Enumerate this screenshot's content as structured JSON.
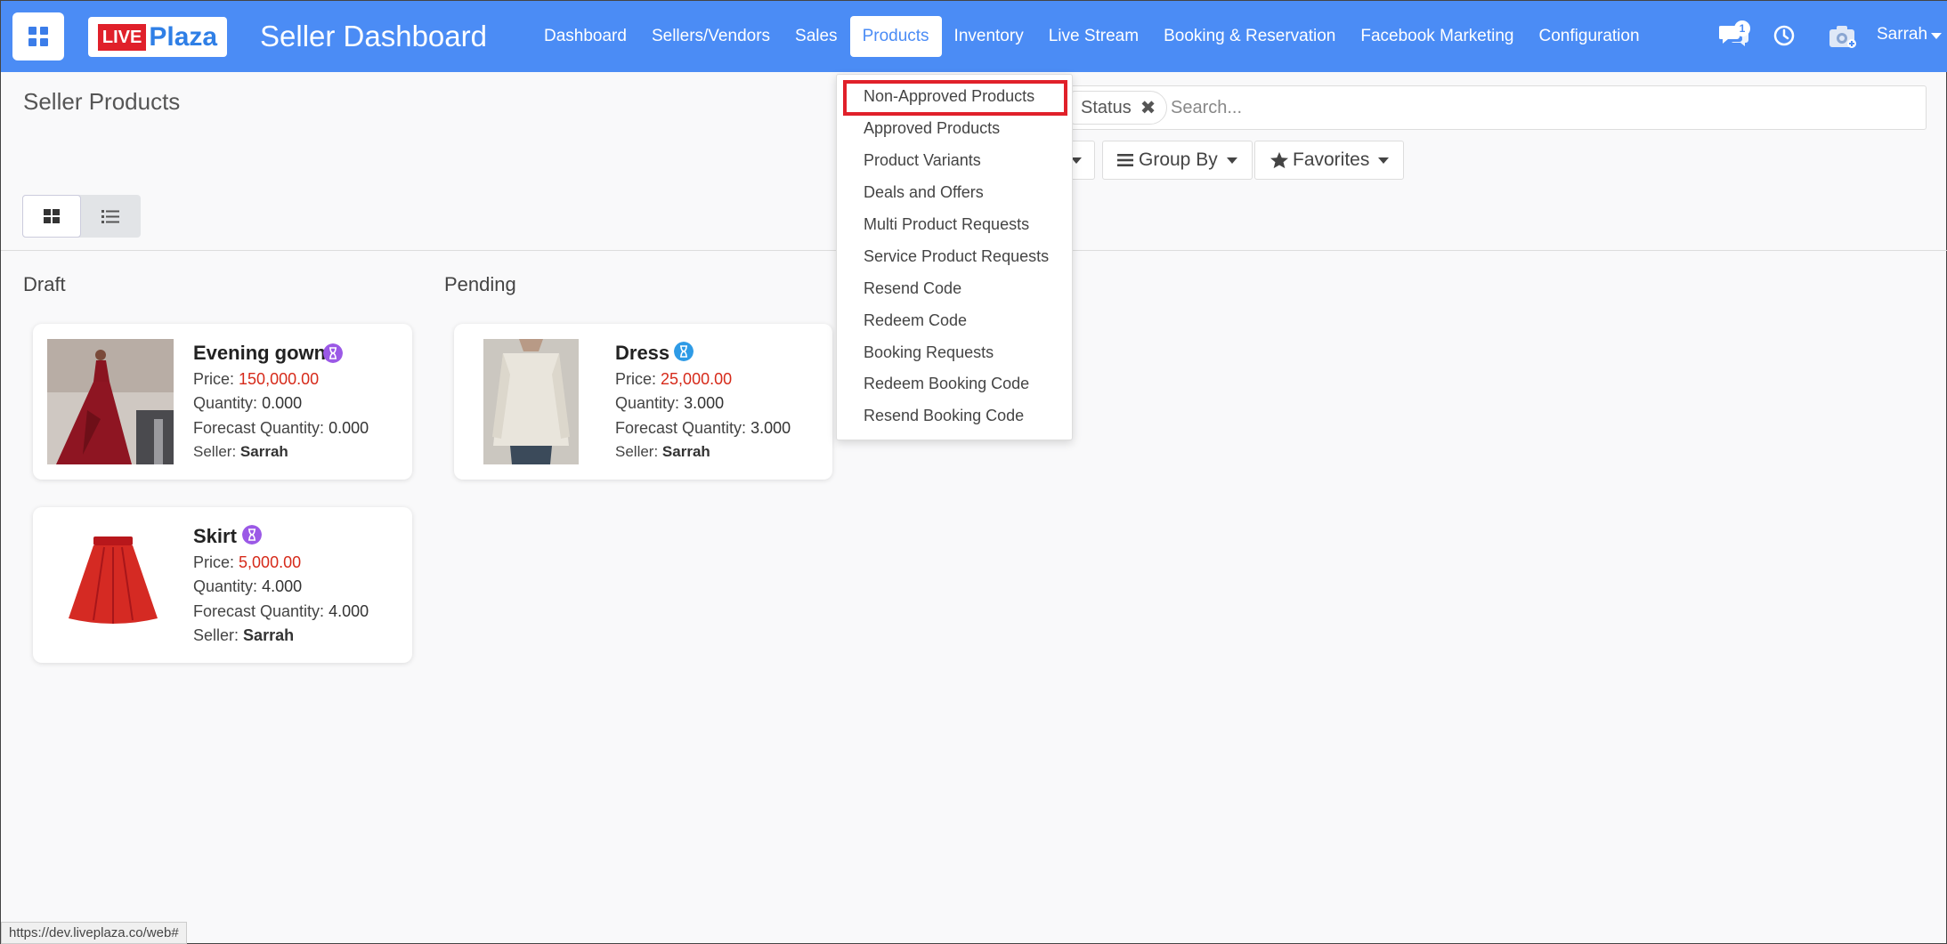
{
  "header": {
    "logo_live": "LIVE",
    "logo_plaza": "Plaza",
    "app_title": "Seller Dashboard",
    "nav": [
      {
        "label": "Dashboard"
      },
      {
        "label": "Sellers/Vendors"
      },
      {
        "label": "Sales"
      },
      {
        "label": "Products"
      },
      {
        "label": "Inventory"
      },
      {
        "label": "Live Stream"
      },
      {
        "label": "Booking & Reservation"
      },
      {
        "label": "Facebook Marketing"
      },
      {
        "label": "Configuration"
      }
    ],
    "active_nav": "Products",
    "chat_count": "1",
    "user_name": "Sarrah",
    "accent_color": "#4b8cf5"
  },
  "control_panel": {
    "page_title": "Seller Products",
    "facet_label": "Status",
    "search_placeholder": "Search...",
    "group_by_label": "Group By",
    "favorites_label": "Favorites"
  },
  "products_menu": {
    "items": [
      {
        "label": "Non-Approved Products"
      },
      {
        "label": "Approved Products"
      },
      {
        "label": "Product Variants"
      },
      {
        "label": "Deals and Offers"
      },
      {
        "label": "Multi Product Requests"
      },
      {
        "label": "Service Product Requests"
      },
      {
        "label": "Resend Code"
      },
      {
        "label": "Redeem Code"
      },
      {
        "label": "Booking Requests"
      },
      {
        "label": "Redeem Booking Code"
      },
      {
        "label": "Resend Booking Code"
      }
    ],
    "highlighted": "Non-Approved Products"
  },
  "kanban": {
    "columns": [
      {
        "title": "Draft",
        "cards": [
          {
            "name": "Evening gown",
            "price_label": "Price:",
            "price": "150,000.00",
            "quantity_label": "Quantity:",
            "quantity": "0.000",
            "forecast_label": "Forecast Quantity:",
            "forecast": "0.000",
            "seller_label": "Seller:",
            "seller": "Sarrah",
            "badge_icon": "hourglass-icon"
          },
          {
            "name": "Skirt",
            "price_label": "Price:",
            "price": "5,000.00",
            "quantity_label": "Quantity:",
            "quantity": "4.000",
            "forecast_label": "Forecast Quantity:",
            "forecast": "4.000",
            "seller_label": "Seller:",
            "seller": "Sarrah",
            "badge_icon": "hourglass-icon"
          }
        ]
      },
      {
        "title": "Pending",
        "cards": [
          {
            "name": "Dress",
            "price_label": "Price:",
            "price": "25,000.00",
            "quantity_label": "Quantity:",
            "quantity": "3.000",
            "forecast_label": "Forecast Quantity:",
            "forecast": "3.000",
            "seller_label": "Seller:",
            "seller": "Sarrah",
            "badge_icon": "hourglass-icon"
          }
        ]
      }
    ]
  },
  "status_url": "https://dev.liveplaza.co/web#"
}
